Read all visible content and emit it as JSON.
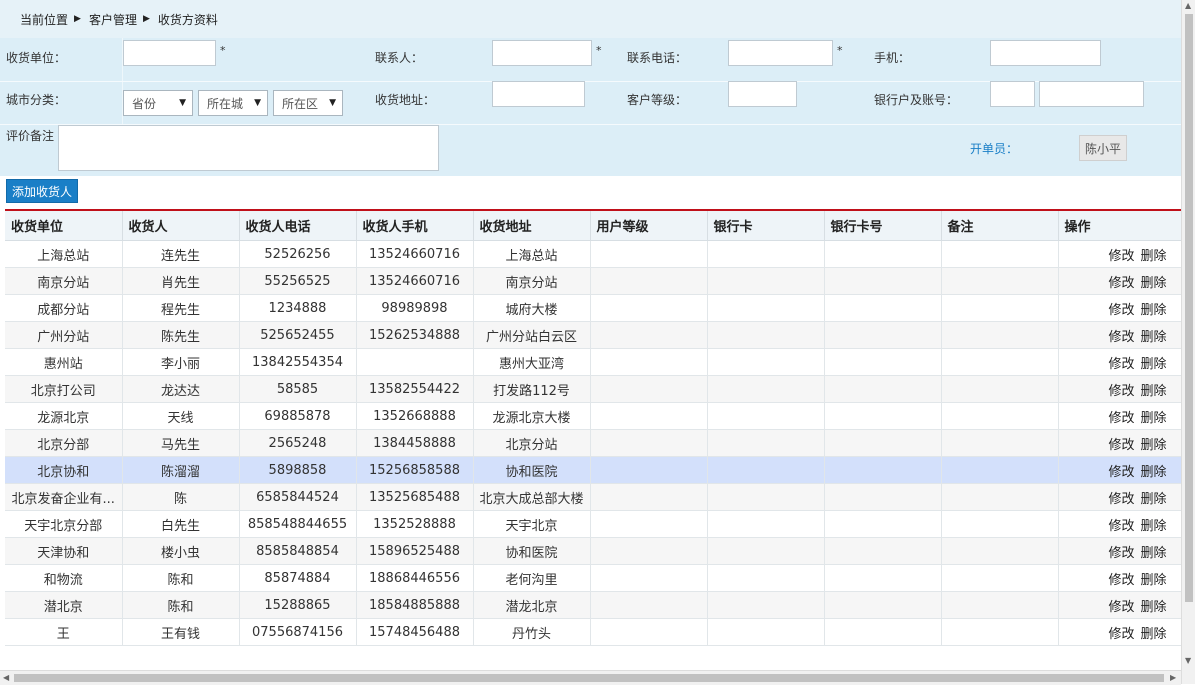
{
  "breadcrumb": {
    "items": [
      "当前位置",
      "客户管理",
      "收货方资料"
    ]
  },
  "form": {
    "receiver_unit_label": "收货单位：",
    "contact_label": "联系人：",
    "phone_label": "联系电话：",
    "mobile_label": "手机：",
    "city_label": "城市分类：",
    "province_select": "省份",
    "city_select": "所在城",
    "district_select": "所在区",
    "address_label": "收货地址：",
    "level_label": "客户等级：",
    "bank_label": "银行户及账号：",
    "remark_label": "评价备注",
    "operator_label": "开单员：",
    "operator_value": "陈小平",
    "required_mark": "*"
  },
  "toolbar": {
    "add_label": "添加收货人"
  },
  "table": {
    "headers": [
      "收货单位",
      "收货人",
      "收货人电话",
      "收货人手机",
      "收货地址",
      "用户等级",
      "银行卡",
      "银行卡号",
      "备注",
      "操作"
    ],
    "edit_label": "修改",
    "delete_label": "删除",
    "rows": [
      {
        "unit": "上海总站",
        "person": "连先生",
        "phone": "52526256",
        "mobile": "13524660716",
        "address": "上海总站"
      },
      {
        "unit": "南京分站",
        "person": "肖先生",
        "phone": "55256525",
        "mobile": "13524660716",
        "address": "南京分站"
      },
      {
        "unit": "成都分站",
        "person": "程先生",
        "phone": "1234888",
        "mobile": "98989898",
        "address": "城府大楼"
      },
      {
        "unit": "广州分站",
        "person": "陈先生",
        "phone": "525652455",
        "mobile": "15262534888",
        "address": "广州分站白云区"
      },
      {
        "unit": "惠州站",
        "person": "李小丽",
        "phone": "13842554354",
        "mobile": "",
        "address": "惠州大亚湾"
      },
      {
        "unit": "北京打公司",
        "person": "龙达达",
        "phone": "58585",
        "mobile": "13582554422",
        "address": "打发路112号"
      },
      {
        "unit": "龙源北京",
        "person": "天线",
        "phone": "69885878",
        "mobile": "1352668888",
        "address": "龙源北京大楼"
      },
      {
        "unit": "北京分部",
        "person": "马先生",
        "phone": "2565248",
        "mobile": "1384458888",
        "address": "北京分站"
      },
      {
        "unit": "北京协和",
        "person": "陈溜溜",
        "phone": "5898858",
        "mobile": "15256858588",
        "address": "协和医院"
      },
      {
        "unit": "北京发奋企业有...",
        "person": "陈",
        "phone": "6585844524",
        "mobile": "13525685488",
        "address": "北京大成总部大楼"
      },
      {
        "unit": "天宇北京分部",
        "person": "白先生",
        "phone": "858548844655",
        "mobile": "1352528888",
        "address": "天宇北京"
      },
      {
        "unit": "天津协和",
        "person": "楼小虫",
        "phone": "8585848854",
        "mobile": "15896525488",
        "address": "协和医院"
      },
      {
        "unit": "和物流",
        "person": "陈和",
        "phone": "85874884",
        "mobile": "18868446556",
        "address": "老何沟里"
      },
      {
        "unit": "潜北京",
        "person": "陈和",
        "phone": "15288865",
        "mobile": "18584885888",
        "address": "潜龙北京"
      },
      {
        "unit": "王",
        "person": "王有钱",
        "phone": "07556874156",
        "mobile": "15748456488",
        "address": "丹竹头"
      }
    ]
  }
}
